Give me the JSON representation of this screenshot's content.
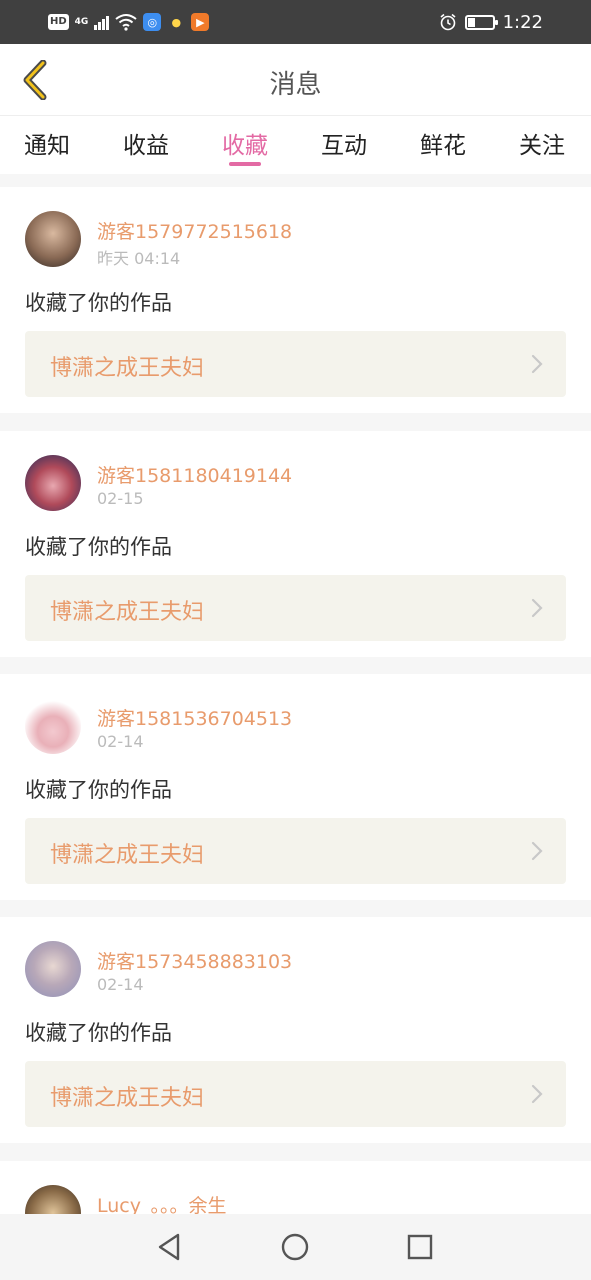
{
  "status_bar": {
    "hd_badge": "HD",
    "network": "4G",
    "time": "1:22",
    "battery_level": 0.3,
    "icons": [
      "hd-icon",
      "signal-icon",
      "wifi-icon",
      "app-icon",
      "bulb-icon",
      "play-app-icon",
      "alarm-icon",
      "battery-icon"
    ]
  },
  "header": {
    "title": "消息",
    "back_icon": "chevron-left-icon"
  },
  "tabs": [
    {
      "label": "通知",
      "active": false
    },
    {
      "label": "收益",
      "active": false
    },
    {
      "label": "收藏",
      "active": true
    },
    {
      "label": "互动",
      "active": false
    },
    {
      "label": "鲜花",
      "active": false
    },
    {
      "label": "关注",
      "active": false
    }
  ],
  "accent_color": "#e36aa4",
  "name_color": "#e89b6c",
  "messages": [
    {
      "user": "游客1579772515618",
      "time": "昨天 04:14",
      "action": "收藏了你的作品",
      "work": "博潇之成王夫妇"
    },
    {
      "user": "游客1581180419144",
      "time": "02-15",
      "action": "收藏了你的作品",
      "work": "博潇之成王夫妇"
    },
    {
      "user": "游客1581536704513",
      "time": "02-14",
      "action": "收藏了你的作品",
      "work": "博潇之成王夫妇"
    },
    {
      "user": "游客1573458883103",
      "time": "02-14",
      "action": "收藏了你的作品",
      "work": "博潇之成王夫妇"
    },
    {
      "user": "Lucy_。。。余生"
    }
  ],
  "nav_bar": {
    "icons": [
      "back-triangle-icon",
      "home-circle-icon",
      "recents-square-icon"
    ]
  }
}
